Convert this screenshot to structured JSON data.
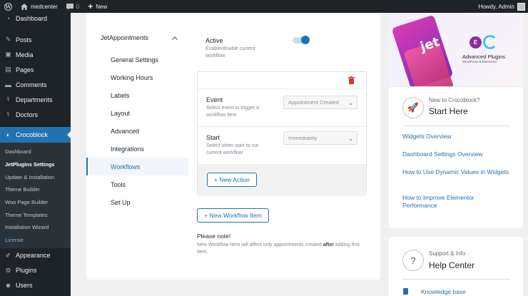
{
  "adminbar": {
    "site_name": "medcenter",
    "comments_count": "0",
    "new_label": "New",
    "greeting": "Howdy, Admin"
  },
  "sidebar": {
    "top_items": [
      {
        "label": "Dashboard",
        "icon": "gauge-icon"
      }
    ],
    "items": [
      {
        "label": "Posts",
        "icon": "pin-icon"
      },
      {
        "label": "Media",
        "icon": "media-icon"
      },
      {
        "label": "Pages",
        "icon": "page-icon"
      },
      {
        "label": "Comments",
        "icon": "comment-icon"
      },
      {
        "label": "Departments",
        "icon": "stethoscope-icon"
      },
      {
        "label": "Doctors",
        "icon": "stethoscope-icon"
      }
    ],
    "current": {
      "label": "Crocoblock",
      "icon": "crocoblock-icon"
    },
    "submenu": [
      "Dashboard",
      "JetPlugins Settings",
      "Update & Installation",
      "Theme Builder",
      "Woo Page Builder",
      "Theme Templates",
      "Installation Wizard",
      "License"
    ],
    "bottom_items": [
      {
        "label": "Appearance",
        "icon": "brush-icon"
      },
      {
        "label": "Plugins",
        "icon": "plugin-icon"
      },
      {
        "label": "Users",
        "icon": "users-icon"
      }
    ]
  },
  "settings_nav": {
    "group": "JetAppointments",
    "items": [
      "General Settings",
      "Working Hours",
      "Labels",
      "Layout",
      "Advanced",
      "Integrations",
      "Workflows",
      "Tools",
      "Set Up"
    ]
  },
  "workflow": {
    "active_label": "Active",
    "active_desc": "Enable/disable current workflow",
    "active_on": true,
    "event_label": "Event",
    "event_desc": "Select event to trigger a workflow item",
    "event_value": "Appointment Created",
    "start_label": "Start",
    "start_desc": "Select when start to run current workflow",
    "start_value": "Immediately",
    "new_action": "+ New Action",
    "new_workflow_item": "+ New Workflow Item",
    "note_title": "Please note!",
    "note_before": "New Workflow Item will affect only appointments created ",
    "note_bold": "after",
    "note_after": " adding this Item."
  },
  "promo": {
    "brand": "jet",
    "title": "Advanced Plugins",
    "subtitle": "WordPress & Elementor"
  },
  "croco_card": {
    "kicker": "New to Crocoblock?",
    "title": "Start Here",
    "links": [
      "Widgets Overview",
      "Dashboard Settings Overview",
      "How to Use Dynamic Values in Widgets",
      "How to Improve Elementor Performance"
    ]
  },
  "help_card": {
    "kicker": "Support & Info",
    "title": "Help Center",
    "link": "Knowledge base"
  }
}
